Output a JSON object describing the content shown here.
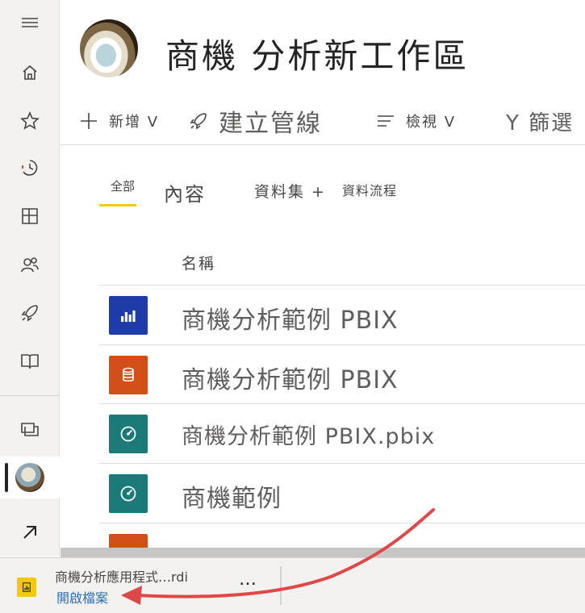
{
  "nav_rail": {
    "items": [
      {
        "name": "hamburger-icon"
      },
      {
        "name": "home-icon"
      },
      {
        "name": "star-icon"
      },
      {
        "name": "recent-icon"
      },
      {
        "name": "apps-icon"
      },
      {
        "name": "shared-icon"
      },
      {
        "name": "deployment-icon"
      },
      {
        "name": "learn-icon"
      },
      {
        "name": "workspaces-icon"
      },
      {
        "name": "workspace-avatar"
      },
      {
        "name": "expand-icon"
      }
    ]
  },
  "header": {
    "title": "商機 分析新工作區"
  },
  "toolbar": {
    "new_label": "新增 V",
    "pipeline_label": "建立管線",
    "view_label": "檢視 V",
    "filter_label": "Y 篩選"
  },
  "tabs": {
    "all": "全部",
    "content": "內容",
    "datasets": "資料集 +",
    "dataflows": "資料流程"
  },
  "list": {
    "column_name": "名稱",
    "rows": [
      {
        "name": "商機分析範例 PBIX",
        "type_icon": "report-icon",
        "color": "#1f3da8"
      },
      {
        "name": "商機分析範例 PBIX",
        "type_icon": "dataset-icon",
        "color": "#d14f16"
      },
      {
        "name": "商機分析範例 PBIX.pbix",
        "type_icon": "dashboard-icon",
        "color": "#1b7a78"
      },
      {
        "name": "商機範例",
        "type_icon": "dashboard-icon",
        "color": "#1b7a78"
      }
    ]
  },
  "download_bar": {
    "file_name": "商機分析應用程式…rdi",
    "open_label": "開啟檔案",
    "more_label": "…",
    "icon_color": "#f2c811"
  },
  "annotation": {
    "arrow_color": "#e04848"
  }
}
